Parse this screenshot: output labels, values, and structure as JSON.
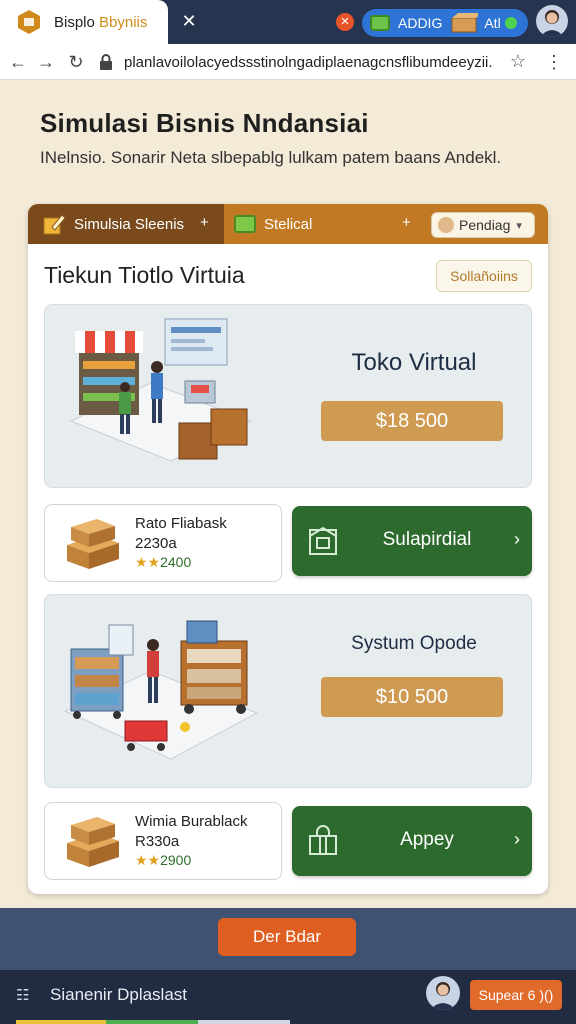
{
  "browser": {
    "tab": {
      "title_main": "Bisplo ",
      "title_accent": "Bbyniis"
    },
    "pill": {
      "label": "ADDIG",
      "label2": "Atl"
    },
    "url": "planlavoilolacyedssstinolngadiplaenagcnsflibumdeeyzii."
  },
  "page": {
    "title": "Simulasi Bisnis Nndansiai",
    "subtitle": "INelnsio. Sonarir Neta slbepablg lulkam patem baans Andekl."
  },
  "card": {
    "tabs": {
      "tab1_label": "Simulsia Sleenis",
      "tab2_label": "Stelical",
      "pending_label": "Pendiag"
    },
    "section_title": "Tiekun Tiotlo Virtuia",
    "solutions_label": "Sollañoiins",
    "features": [
      {
        "title": "Toko Virtual",
        "price": "$18 500"
      },
      {
        "title": "Systum Opode",
        "price": "$10 500"
      }
    ],
    "items": [
      {
        "name": "Rato Fliabask",
        "code": "2230a",
        "rating_value": "2400",
        "action_label": "Sulapirdial"
      },
      {
        "name": "Wimia Burablack",
        "code": "R330a",
        "rating_value": "2900",
        "action_label": "Appey"
      }
    ]
  },
  "bottom": {
    "primary_label": "Der Bdar",
    "status_text": "Sianenir Dplaslast",
    "status_button": "Supear 6 )()"
  },
  "colors": {
    "header_tab_dark": "#7a4a1c",
    "header_tab_orange": "#c17a23",
    "price_button": "#cf9b52",
    "action_green": "#2d6a2d",
    "primary_orange": "#df5f22",
    "bottom_band": "#405272",
    "status_bar": "#212b41"
  }
}
